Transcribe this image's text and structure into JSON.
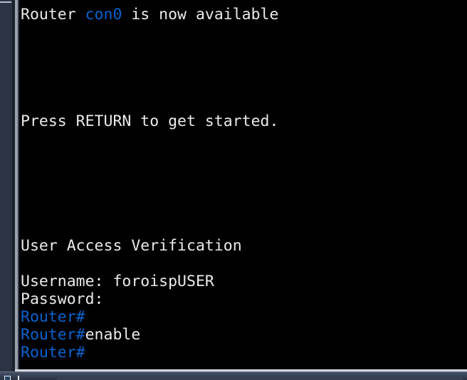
{
  "window": {
    "kind": "cisco-router-console-terminal",
    "background_color": "#000000",
    "text_color": "#eaeaea",
    "prompt_color": "#0a63cf"
  },
  "terminal": {
    "lines": [
      {
        "id": "line-1",
        "segments": [
          {
            "text": "Router ",
            "color": "white"
          },
          {
            "text": "con0",
            "color": "blue"
          },
          {
            "text": " is now available",
            "color": "white"
          }
        ]
      },
      {
        "id": "line-2",
        "segments": [
          {
            "text": "",
            "color": "white"
          }
        ]
      },
      {
        "id": "line-3",
        "segments": [
          {
            "text": "",
            "color": "white"
          }
        ]
      },
      {
        "id": "line-4",
        "segments": [
          {
            "text": "",
            "color": "white"
          }
        ]
      },
      {
        "id": "line-5",
        "segments": [
          {
            "text": "",
            "color": "white"
          }
        ]
      },
      {
        "id": "line-6",
        "segments": [
          {
            "text": "",
            "color": "white"
          }
        ]
      },
      {
        "id": "line-7",
        "segments": [
          {
            "text": "Press RETURN to get started.",
            "color": "white"
          }
        ]
      },
      {
        "id": "line-8",
        "segments": [
          {
            "text": "",
            "color": "white"
          }
        ]
      },
      {
        "id": "line-9",
        "segments": [
          {
            "text": "",
            "color": "white"
          }
        ]
      },
      {
        "id": "line-10",
        "segments": [
          {
            "text": "",
            "color": "white"
          }
        ]
      },
      {
        "id": "line-11",
        "segments": [
          {
            "text": "",
            "color": "white"
          }
        ]
      },
      {
        "id": "line-12",
        "segments": [
          {
            "text": "",
            "color": "white"
          }
        ]
      },
      {
        "id": "line-13",
        "segments": [
          {
            "text": "",
            "color": "white"
          }
        ]
      },
      {
        "id": "line-14",
        "segments": [
          {
            "text": "User Access Verification",
            "color": "white"
          }
        ]
      },
      {
        "id": "line-15",
        "segments": [
          {
            "text": "",
            "color": "white"
          }
        ]
      },
      {
        "id": "line-16",
        "segments": [
          {
            "text": "Username: foroispUSER",
            "color": "white"
          }
        ]
      },
      {
        "id": "line-17",
        "segments": [
          {
            "text": "Password:",
            "color": "white"
          }
        ]
      },
      {
        "id": "line-18",
        "segments": [
          {
            "text": "Router#",
            "color": "blue"
          }
        ]
      },
      {
        "id": "line-19",
        "segments": [
          {
            "text": "Router#",
            "color": "blue"
          },
          {
            "text": "enable",
            "color": "white"
          }
        ]
      },
      {
        "id": "line-20",
        "segments": [
          {
            "text": "Router#",
            "color": "blue"
          }
        ]
      }
    ]
  },
  "taskbar": {
    "visible_fragment": true
  }
}
